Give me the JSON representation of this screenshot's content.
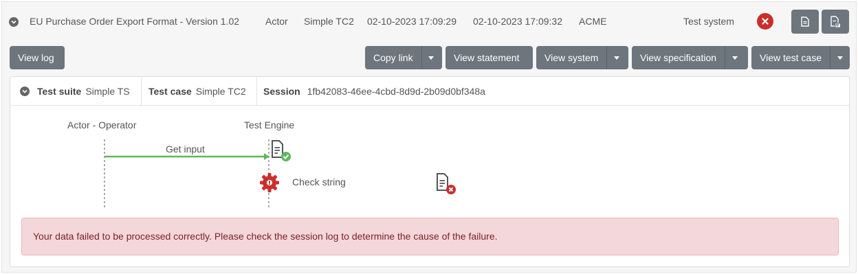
{
  "header": {
    "title": "EU Purchase Order Export Format - Version 1.02",
    "actor": "Actor",
    "test_case": "Simple TC2",
    "start_time": "02-10-2023 17:09:29",
    "end_time": "02-10-2023 17:09:32",
    "organisation": "ACME",
    "system": "Test system",
    "status": "failed"
  },
  "toolbar": {
    "view_log": "View log",
    "copy_link": "Copy link",
    "view_statement": "View statement",
    "view_system": "View system",
    "view_specification": "View specification",
    "view_test_case": "View test case"
  },
  "session": {
    "test_suite_label": "Test suite",
    "test_suite_value": "Simple TS",
    "test_case_label": "Test case",
    "test_case_value": "Simple TC2",
    "session_label": "Session",
    "session_value": "1fb42083-46ee-4cbd-8d9d-2b09d0bf348a"
  },
  "diagram": {
    "lifelines": [
      "Actor - Operator",
      "Test Engine"
    ],
    "messages": [
      {
        "label": "Get input",
        "status": "success"
      },
      {
        "label": "Check string",
        "status": "error"
      }
    ]
  },
  "alert": {
    "message": "Your data failed to be processed correctly. Please check the session log to determine the cause of the failure."
  },
  "colors": {
    "button": "#6d757d",
    "fail": "#c9302c",
    "success": "#5cb85c",
    "alert_bg": "#f4d7da"
  }
}
